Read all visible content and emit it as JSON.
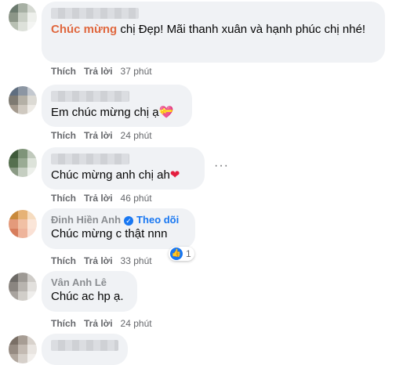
{
  "actions": {
    "like": "Thích",
    "reply": "Trả lời"
  },
  "comments": [
    {
      "highlight": "Chúc mừng",
      "text": " chị Đẹp! Mãi thanh xuân và hạnh phúc chị nhé!",
      "time": "37 phút"
    },
    {
      "text": "Em chúc mừng chị ạ",
      "emoji": "💝",
      "time": "24 phút"
    },
    {
      "text": "Chúc mừng anh chị ah",
      "emoji": "❤",
      "time": "46 phút",
      "more": "···"
    },
    {
      "name": "Đinh Hiền Anh",
      "follow": "Theo dõi",
      "text": "Chúc mừng c thật nnn",
      "time": "33 phút",
      "reaction_count": "1"
    },
    {
      "name": "Vân Anh Lê",
      "text": "Chúc ac hp ạ.",
      "time": "24 phút"
    }
  ],
  "icons": {
    "like": "like-icon",
    "verified": "verified-badge-icon",
    "more": "more-options-icon"
  },
  "colors": {
    "bubble": "#f0f2f5",
    "highlight": "#e0683f",
    "link": "#1877f2",
    "meta": "#65676b"
  }
}
